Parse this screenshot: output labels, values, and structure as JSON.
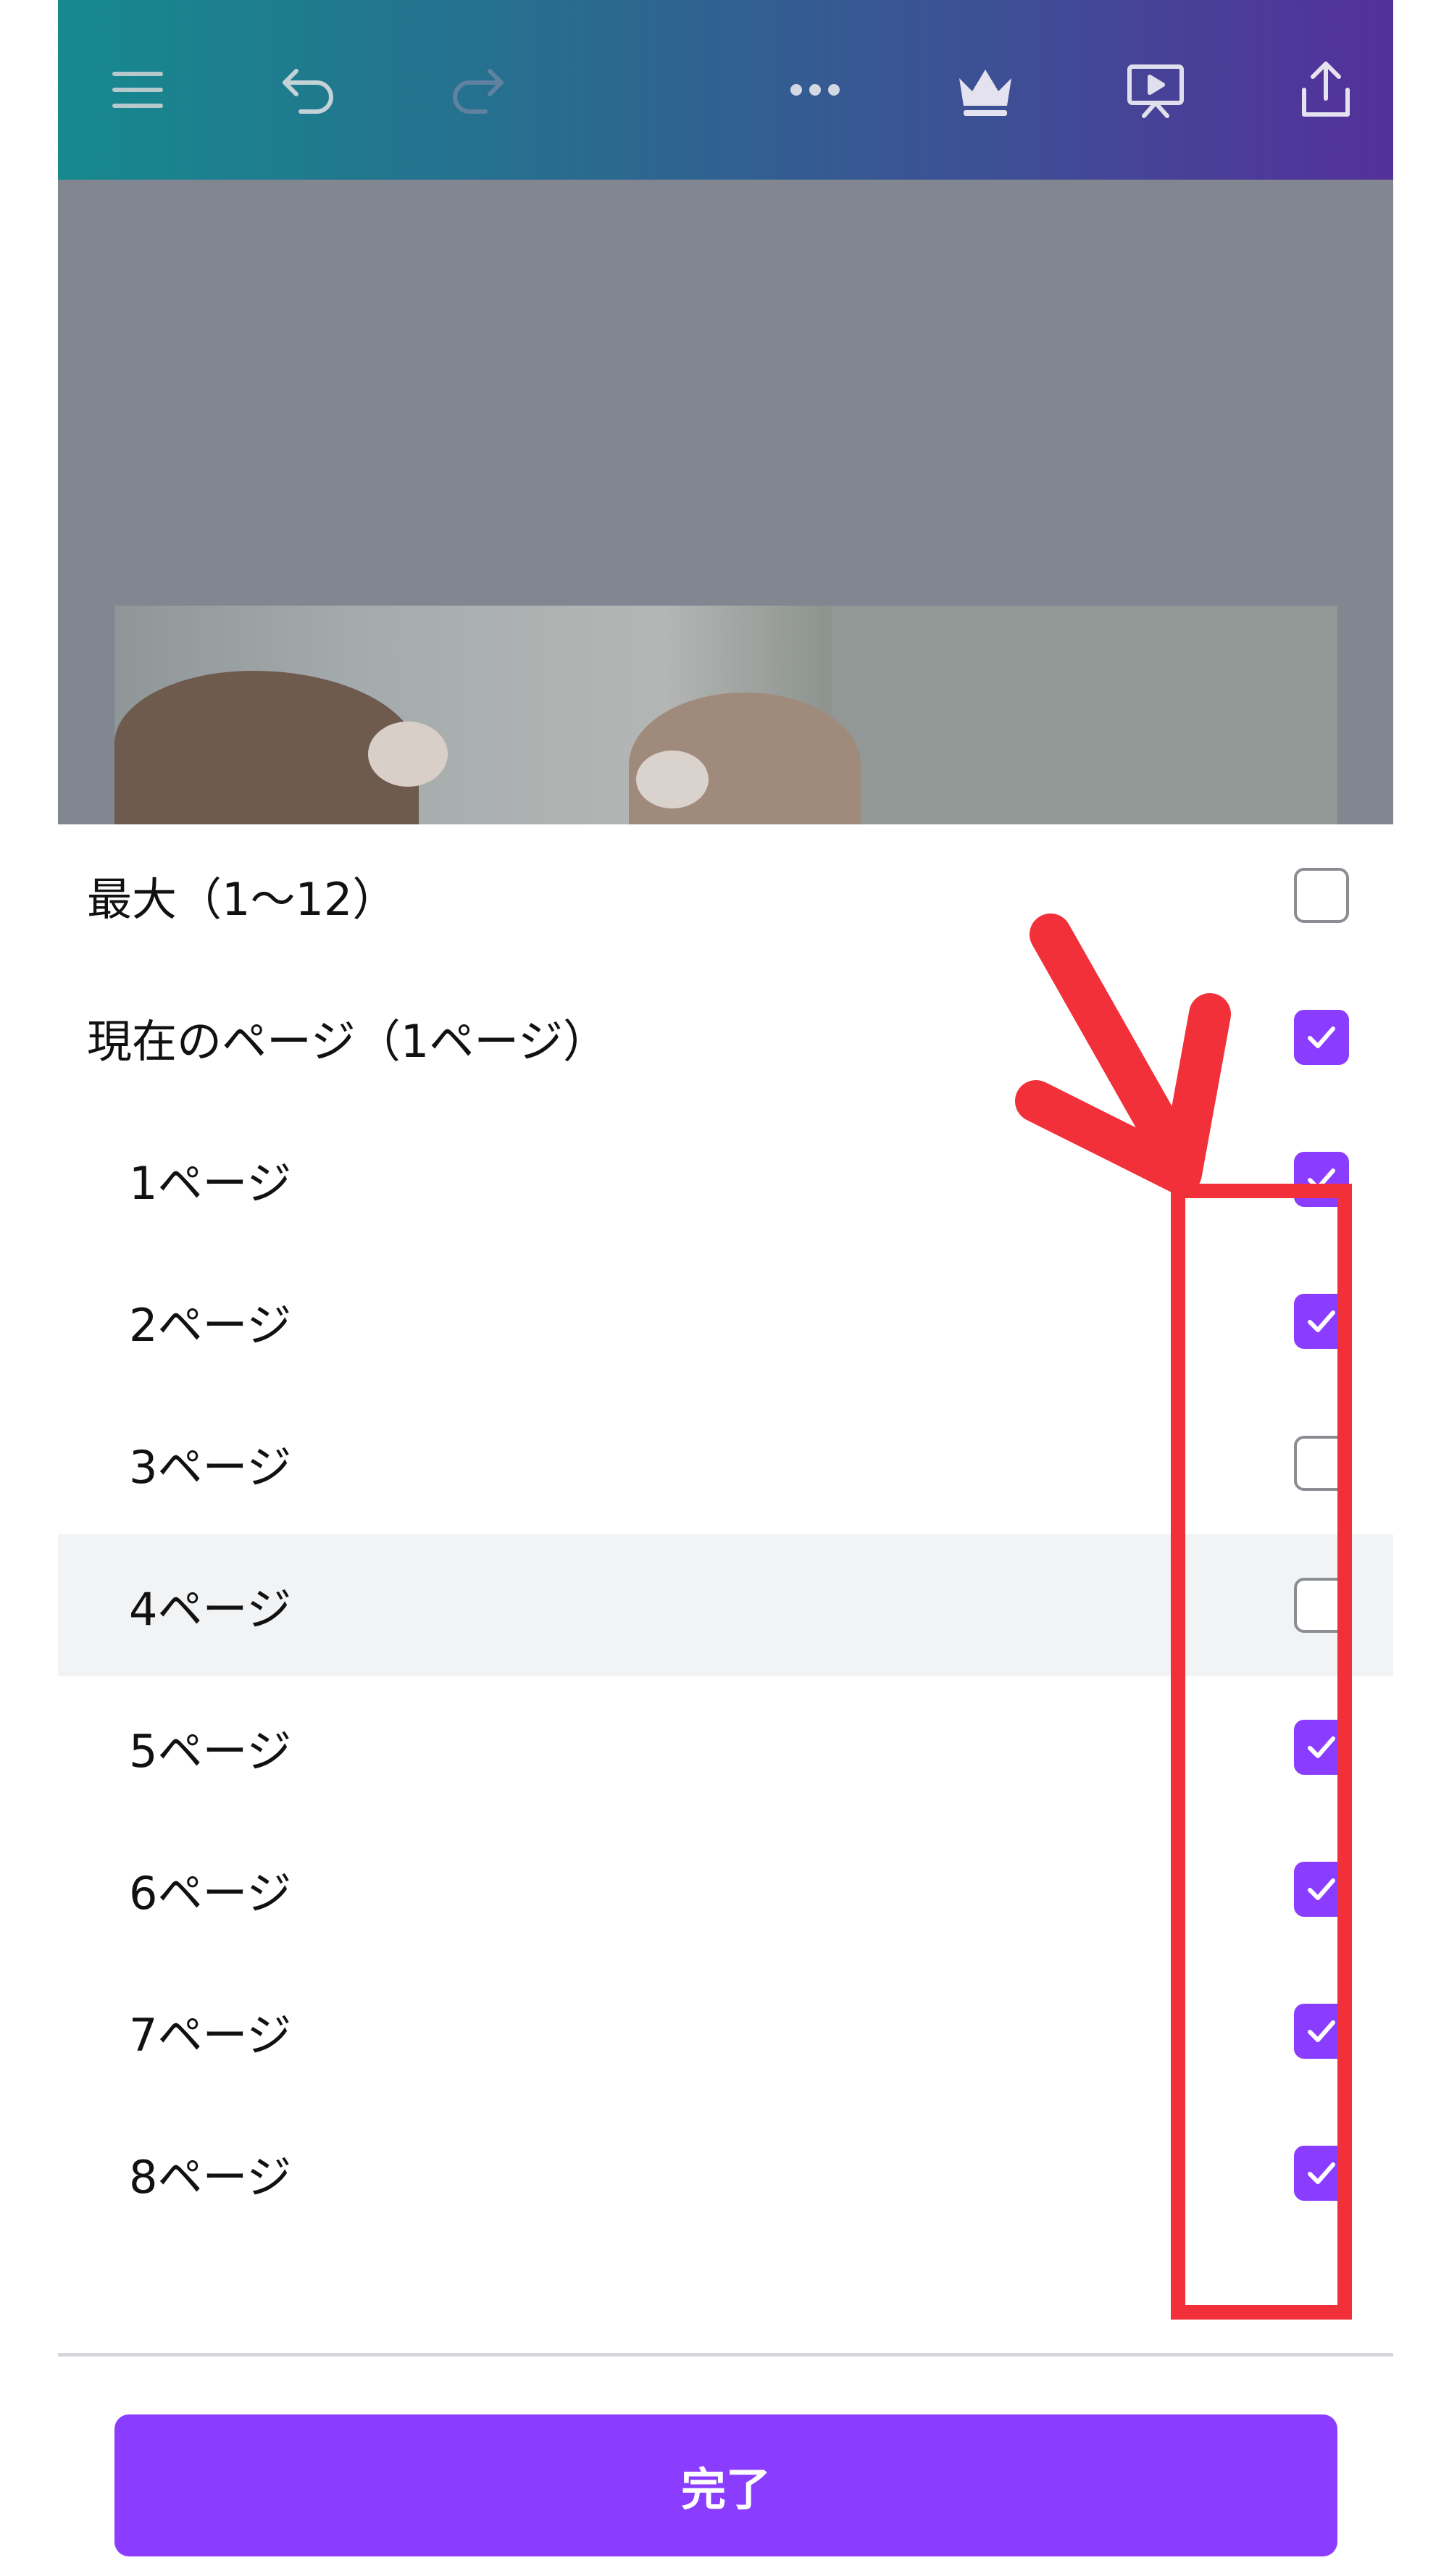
{
  "toolbar": {
    "icons": [
      "menu-icon",
      "undo-icon",
      "redo-icon",
      "more-icon",
      "crown-icon",
      "present-icon",
      "share-icon"
    ]
  },
  "pages_selector": {
    "all_label": "最大（1〜12）",
    "all_checked": false,
    "current_label": "現在のページ（1ページ）",
    "current_checked": true,
    "pages": [
      {
        "label": "1ページ",
        "checked": true
      },
      {
        "label": "2ページ",
        "checked": true
      },
      {
        "label": "3ページ",
        "checked": false
      },
      {
        "label": "4ページ",
        "checked": false
      },
      {
        "label": "5ページ",
        "checked": true
      },
      {
        "label": "6ページ",
        "checked": true
      },
      {
        "label": "7ページ",
        "checked": true
      },
      {
        "label": "8ページ",
        "checked": true
      }
    ]
  },
  "footer": {
    "done_label": "完了"
  },
  "colors": {
    "accent": "#8b3dff",
    "annotation": "#f2303a"
  }
}
